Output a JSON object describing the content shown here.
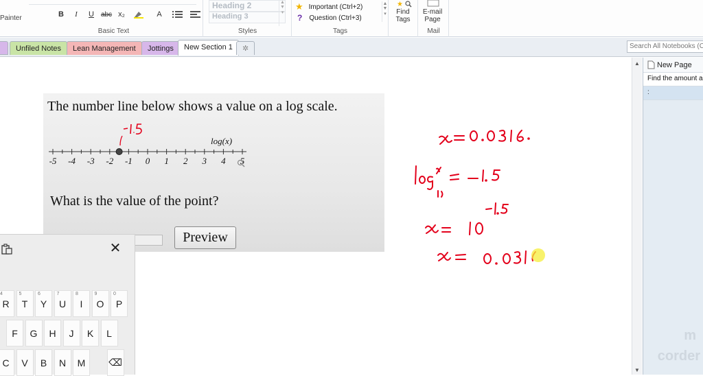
{
  "ribbon": {
    "painter_label": "Painter",
    "basic_text": {
      "label": "Basic Text",
      "bold": "B",
      "italic": "I",
      "underline": "U",
      "strike": "abc",
      "subscript": "x₂",
      "font_color": "A"
    },
    "styles": {
      "label": "Styles",
      "items": [
        "Heading 2",
        "Heading 3"
      ]
    },
    "tags": {
      "label": "Tags",
      "items": [
        {
          "label": "Important (Ctrl+2)",
          "icon": "star-icon"
        },
        {
          "label": "Question (Ctrl+3)",
          "icon": "question-icon"
        }
      ]
    },
    "find_tags": {
      "line1": "Find",
      "line2": "Tags"
    },
    "email": {
      "line1": "E-mail",
      "line2": "Page",
      "group_label": "Mail"
    }
  },
  "tabs": [
    {
      "label": "Unfiled Notes",
      "color": "#c9e4a6"
    },
    {
      "label": "Lean Management",
      "color": "#f4b6b6"
    },
    {
      "label": "Jottings",
      "color": "#d7b7ea"
    },
    {
      "label": "New Section 1",
      "color": "#ffffff",
      "active": true
    },
    {
      "label": "✲",
      "color": "#eaeef3"
    }
  ],
  "search": {
    "placeholder": "Search All Notebooks (C"
  },
  "page_list": {
    "new_page": "New Page",
    "entries": [
      "Find the amount a",
      ":"
    ]
  },
  "question": {
    "line1": "The number line below shows a value on a log scale.",
    "axis_label": "log(x)",
    "ticks": [
      "-5",
      "-4",
      "-3",
      "-2",
      "-1",
      "0",
      "1",
      "2",
      "3",
      "4",
      "5"
    ],
    "point_value": -1.5,
    "annotation": "-1.5",
    "line2": "What is the value of the point?",
    "preview": "Preview"
  },
  "keyboard": {
    "row1": [
      {
        "key": "R",
        "sub": "4"
      },
      {
        "key": "T",
        "sub": "5"
      },
      {
        "key": "Y",
        "sub": "6"
      },
      {
        "key": "U",
        "sub": "7"
      },
      {
        "key": "I",
        "sub": "8"
      },
      {
        "key": "O",
        "sub": "9"
      },
      {
        "key": "P",
        "sub": "0"
      }
    ],
    "row2": [
      "F",
      "G",
      "H",
      "J",
      "K",
      "L"
    ],
    "row3": [
      "C",
      "V",
      "B",
      "N",
      "M",
      "⌫"
    ]
  },
  "watermark": {
    "line1": "m",
    "line2": "corder"
  },
  "colors": {
    "ink": "#e3001b",
    "accent": "#2b579a"
  }
}
